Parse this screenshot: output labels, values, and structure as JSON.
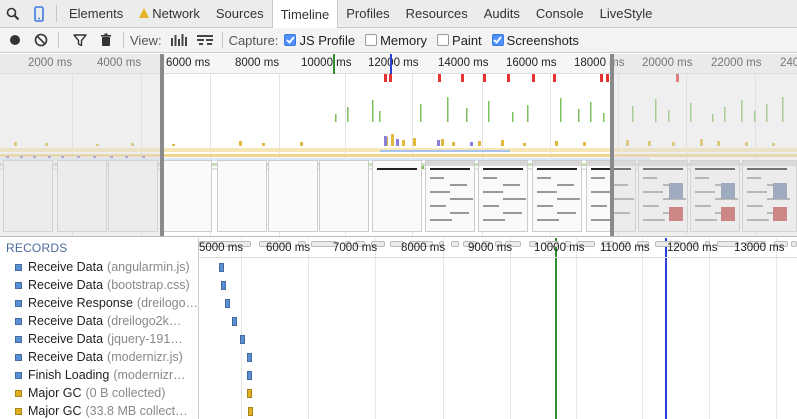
{
  "tabs": [
    {
      "label": "Elements",
      "active": false
    },
    {
      "label": "Network",
      "active": false,
      "warning": true
    },
    {
      "label": "Sources",
      "active": false
    },
    {
      "label": "Timeline",
      "active": true
    },
    {
      "label": "Profiles",
      "active": false
    },
    {
      "label": "Resources",
      "active": false
    },
    {
      "label": "Audits",
      "active": false
    },
    {
      "label": "Console",
      "active": false
    },
    {
      "label": "LiveStyle",
      "active": false
    }
  ],
  "toolbar": {
    "view_label": "View:",
    "capture_label": "Capture:",
    "js_profile": {
      "label": "JS Profile",
      "checked": true
    },
    "memory": {
      "label": "Memory",
      "checked": false
    },
    "paint": {
      "label": "Paint",
      "checked": false
    },
    "screenshots": {
      "label": "Screenshots",
      "checked": true
    }
  },
  "overview": {
    "ticks": [
      "2000 ms",
      "4000 ms",
      "6000 ms",
      "8000 ms",
      "10000 ms",
      "12000 ms",
      "14000 ms",
      "16000 ms",
      "18000 ms",
      "20000 ms",
      "22000 ms",
      "240"
    ],
    "selection_start_ms": 5000,
    "selection_end_ms": 13800,
    "event_markers": {
      "dom_content_loaded_ms": 10100,
      "load_ms": 11100
    }
  },
  "records": {
    "heading": "RECORDS",
    "items": [
      {
        "title": "Receive Data",
        "detail": "(angularmin.js)",
        "color": "#5a8fd6"
      },
      {
        "title": "Receive Data",
        "detail": "(bootstrap.css)",
        "color": "#5a8fd6"
      },
      {
        "title": "Receive Response",
        "detail": "(dreilogo…",
        "color": "#5a8fd6"
      },
      {
        "title": "Receive Data",
        "detail": "(dreilogo2k…",
        "color": "#5a8fd6"
      },
      {
        "title": "Receive Data",
        "detail": "(jquery-191…",
        "color": "#5a8fd6"
      },
      {
        "title": "Receive Data",
        "detail": "(modernizr.js)",
        "color": "#5a8fd6"
      },
      {
        "title": "Finish Loading",
        "detail": "(modernizr…",
        "color": "#5a8fd6"
      },
      {
        "title": "Major GC",
        "detail": "(0 B collected)",
        "color": "#e0b020"
      },
      {
        "title": "Major GC",
        "detail": "(33.8 MB collect…",
        "color": "#e0b020"
      }
    ]
  },
  "detail": {
    "ticks": [
      "5000 ms",
      "6000 ms",
      "7000 ms",
      "8000 ms",
      "9000 ms",
      "10000 ms",
      "11000 ms",
      "12000 ms",
      "13000 ms"
    ]
  }
}
